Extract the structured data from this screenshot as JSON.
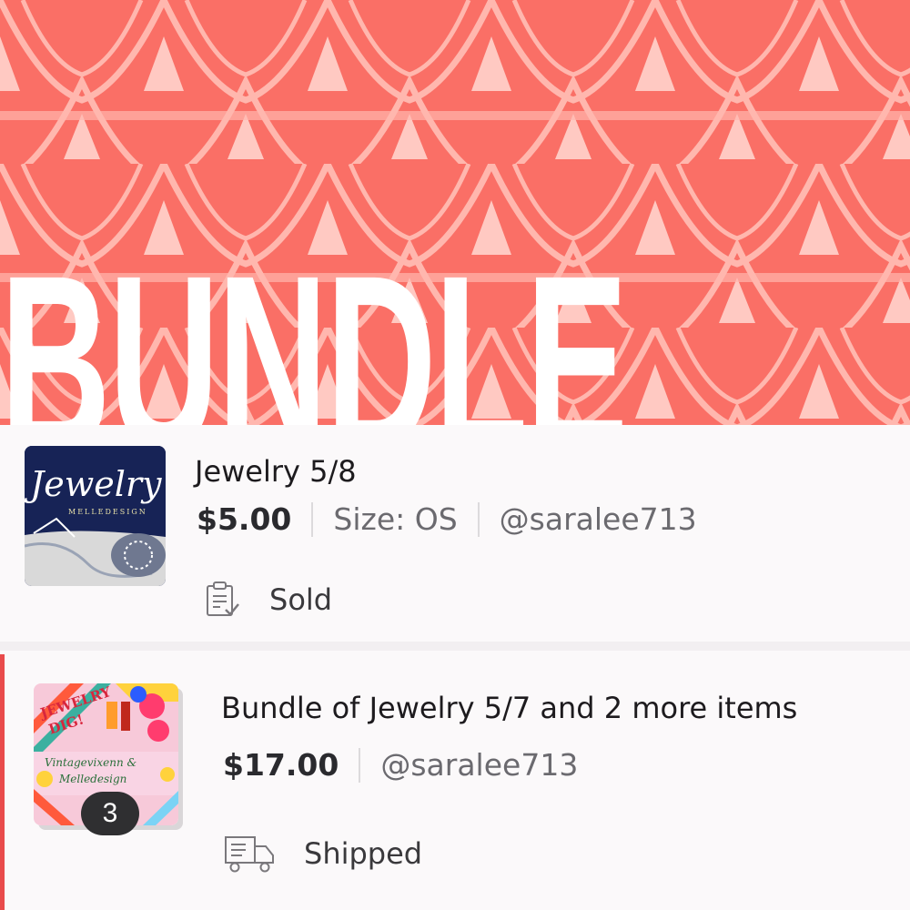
{
  "banner": {
    "title": "BUNDLE"
  },
  "listings": [
    {
      "thumbnail": {
        "title_text": "Jewelry",
        "sub_text": "MELLEDESIGN"
      },
      "title": "Jewelry 5/8",
      "price": "$5.00",
      "size": "Size: OS",
      "seller": "@saralee713",
      "status": "Sold",
      "status_icon": "clipboard-check-icon"
    },
    {
      "thumbnail": {
        "line1": "JEWELRY",
        "line2": "DIG!",
        "line3": "Vintagevixenn &",
        "line4": "Melledesign",
        "count": "3"
      },
      "title": "Bundle of Jewelry 5/7 and 2 more items",
      "price": "$17.00",
      "seller": "@saralee713",
      "status": "Shipped",
      "status_icon": "delivery-truck-icon"
    }
  ],
  "colors": {
    "banner_red": "#fa6f66",
    "pattern_light": "#ffc7c0",
    "accent": "#e94b4b"
  }
}
